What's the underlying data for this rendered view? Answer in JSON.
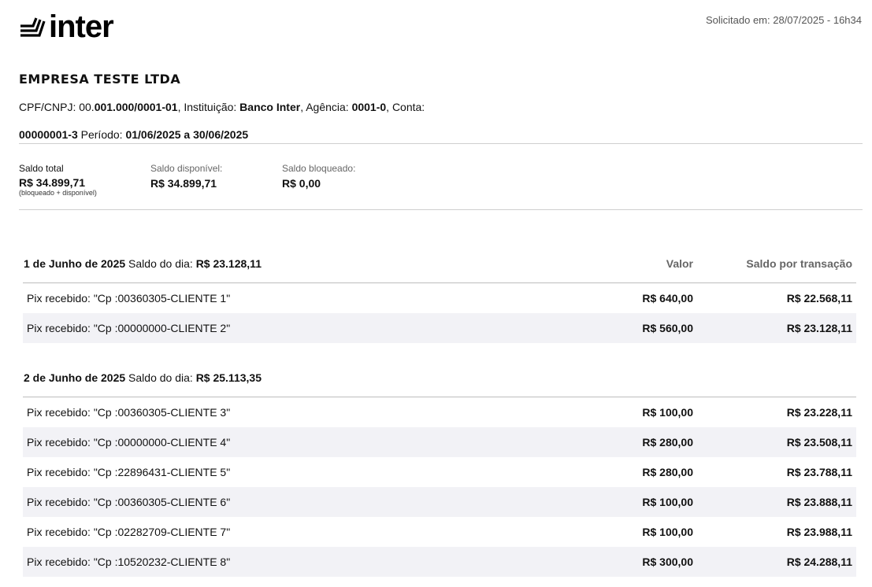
{
  "header": {
    "logo_text": "inter",
    "requested_at": "Solicitado em: 28/07/2025 - 16h34"
  },
  "company": {
    "name": "EMPRESA TESTE LTDA",
    "cpf_label": "CPF/CNPJ: ",
    "cpf_prefix": "00.",
    "cpf_value": "001.000/0001-01",
    "institution_label": ", Instituição: ",
    "institution_value": "Banco Inter",
    "agency_label": ", Agência: ",
    "agency_value": "0001-0",
    "account_label": ", Conta:",
    "account_value": "00000001-3",
    "period_label": " Período: ",
    "period_value": "01/06/2025 a 30/06/2025"
  },
  "balances": {
    "total_label": "Saldo total",
    "total_value": "R$ 34.899,71",
    "total_note": "(bloqueado + disponível)",
    "available_label": "Saldo disponível:",
    "available_value": "R$ 34.899,71",
    "blocked_label": "Saldo bloqueado:",
    "blocked_value": "R$ 0,00"
  },
  "columns": {
    "valor": "Valor",
    "saldo": "Saldo por transação"
  },
  "days": [
    {
      "date": "1 de Junho de 2025",
      "balance_label": " Saldo do dia: ",
      "balance_value": "R$ 23.128,11",
      "transactions": [
        {
          "description": "Pix recebido: \"Cp :00360305-CLIENTE 1\"",
          "value": "R$ 640,00",
          "balance": "R$ 22.568,11"
        },
        {
          "description": "Pix recebido: \"Cp :00000000-CLIENTE 2\"",
          "value": "R$ 560,00",
          "balance": "R$ 23.128,11"
        }
      ]
    },
    {
      "date": "2 de Junho de 2025",
      "balance_label": " Saldo do dia: ",
      "balance_value": "R$ 25.113,35",
      "transactions": [
        {
          "description": "Pix recebido: \"Cp :00360305-CLIENTE 3\"",
          "value": "R$ 100,00",
          "balance": "R$ 23.228,11"
        },
        {
          "description": "Pix recebido: \"Cp :00000000-CLIENTE 4\"",
          "value": "R$ 280,00",
          "balance": "R$ 23.508,11"
        },
        {
          "description": "Pix recebido: \"Cp :22896431-CLIENTE 5\"",
          "value": "R$ 280,00",
          "balance": "R$ 23.788,11"
        },
        {
          "description": "Pix recebido: \"Cp :00360305-CLIENTE 6\"",
          "value": "R$ 100,00",
          "balance": "R$ 23.888,11"
        },
        {
          "description": "Pix recebido: \"Cp :02282709-CLIENTE 7\"",
          "value": "R$ 100,00",
          "balance": "R$ 23.988,11"
        },
        {
          "description": "Pix recebido: \"Cp :10520232-CLIENTE 8\"",
          "value": "R$ 300,00",
          "balance": "R$ 24.288,11"
        }
      ]
    }
  ]
}
